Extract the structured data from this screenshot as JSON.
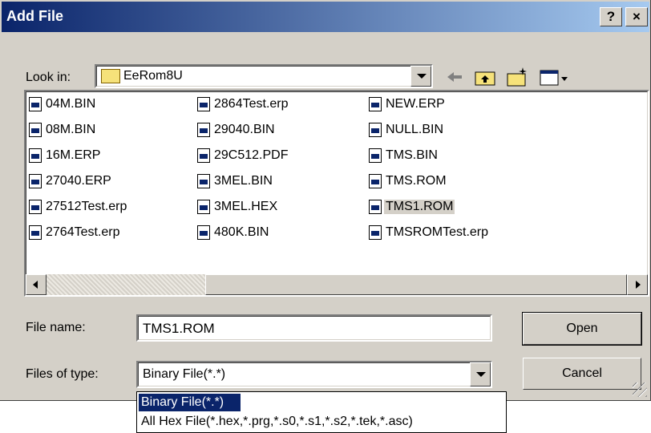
{
  "window": {
    "title": "Add File",
    "help_label": "?",
    "close_label": "×"
  },
  "lookin": {
    "label": "Look in:",
    "folder": "EeRom8U"
  },
  "toolbar": [
    "back-icon",
    "up-folder-icon",
    "new-folder-icon",
    "view-menu-icon"
  ],
  "files": {
    "col1": [
      "04M.BIN",
      "08M.BIN",
      "16M.ERP",
      "27040.ERP",
      "27512Test.erp",
      "2764Test.erp"
    ],
    "col2": [
      "2864Test.erp",
      "29040.BIN",
      "29C512.PDF",
      "3MEL.BIN",
      "3MEL.HEX",
      "480K.BIN"
    ],
    "col3": [
      "NEW.ERP",
      "NULL.BIN",
      "TMS.BIN",
      "TMS.ROM",
      "TMS1.ROM",
      "TMSROMTest.erp"
    ],
    "selected": "TMS1.ROM"
  },
  "filename": {
    "label": "File name:",
    "value": "TMS1.ROM"
  },
  "filetype": {
    "label": "Files of type:",
    "value": "Binary File(*.*)",
    "options": [
      "Binary File(*.*)",
      "All Hex File(*.hex,*.prg,*.s0,*.s1,*.s2,*.tek,*.asc)"
    ]
  },
  "buttons": {
    "open": "Open",
    "cancel": "Cancel"
  },
  "colors": {
    "title_start": "#0a246a",
    "title_end": "#a6caf0",
    "face": "#d4d0c8",
    "highlight": "#0a246a"
  }
}
